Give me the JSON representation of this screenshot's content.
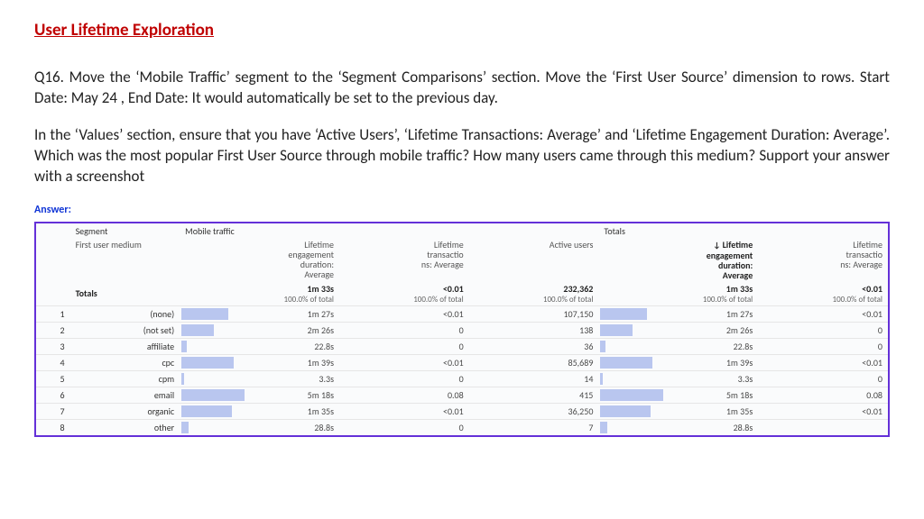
{
  "title": "User Lifetime Exploration",
  "para1": "Q16. Move the ‘Mobile Traffic’ segment to the ‘Segment Comparisons’ section. Move the ‘First User Source’ dimension to rows. Start Date: May 24 , End Date: It would automatically be set to the previous day.",
  "para2": "In the ‘Values’ section, ensure that you have ‘Active Users’, ‘Lifetime Transactions: Average’ and ‘Lifetime Engagement Duration: Average’. Which was the most popular First User Source through mobile traffic? How many users came through this medium? Support your answer with a screenshot",
  "answer_label": "Answer:",
  "table": {
    "segment_label": "Segment",
    "segment_value": "Mobile traffic",
    "totals_header": "Totals",
    "dimension_label": "First user medium",
    "columns": [
      "Lifetime engagement duration: Average",
      "Lifetime transactio ns: Average",
      "Active users",
      "↓ Lifetime engagement duration: Average",
      "Lifetime transactio ns: Average"
    ],
    "totals_label": "Totals",
    "totals": [
      "1m 33s",
      "<0.01",
      "232,362",
      "1m 33s",
      "<0.01"
    ],
    "totals_sub": [
      "100.0% of total",
      "100.0% of total",
      "100.0% of total",
      "100.0% of total",
      "100.0% of total"
    ],
    "rows": [
      {
        "idx": "1",
        "medium": "(none)",
        "c": [
          "1m 27s",
          "<0.01",
          "107,150",
          "1m 27s",
          "<0.01"
        ],
        "bar": 52
      },
      {
        "idx": "2",
        "medium": "(not set)",
        "c": [
          "2m 26s",
          "0",
          "138",
          "2m 26s",
          "0"
        ],
        "bar": 36
      },
      {
        "idx": "3",
        "medium": "affiliate",
        "c": [
          "22.8s",
          "0",
          "36",
          "22.8s",
          "0"
        ],
        "bar": 6
      },
      {
        "idx": "4",
        "medium": "cpc",
        "c": [
          "1m 39s",
          "<0.01",
          "85,689",
          "1m 39s",
          "<0.01"
        ],
        "bar": 58
      },
      {
        "idx": "5",
        "medium": "cpm",
        "c": [
          "3.3s",
          "0",
          "14",
          "3.3s",
          "0"
        ],
        "bar": 3
      },
      {
        "idx": "6",
        "medium": "email",
        "c": [
          "5m 18s",
          "0.08",
          "415",
          "5m 18s",
          "0.08"
        ],
        "bar": 70
      },
      {
        "idx": "7",
        "medium": "organic",
        "c": [
          "1m 35s",
          "<0.01",
          "36,250",
          "1m 35s",
          "<0.01"
        ],
        "bar": 56
      },
      {
        "idx": "8",
        "medium": "other",
        "c": [
          "28.8s",
          "0",
          "7",
          "28.8s",
          ""
        ],
        "bar": 8
      }
    ]
  }
}
